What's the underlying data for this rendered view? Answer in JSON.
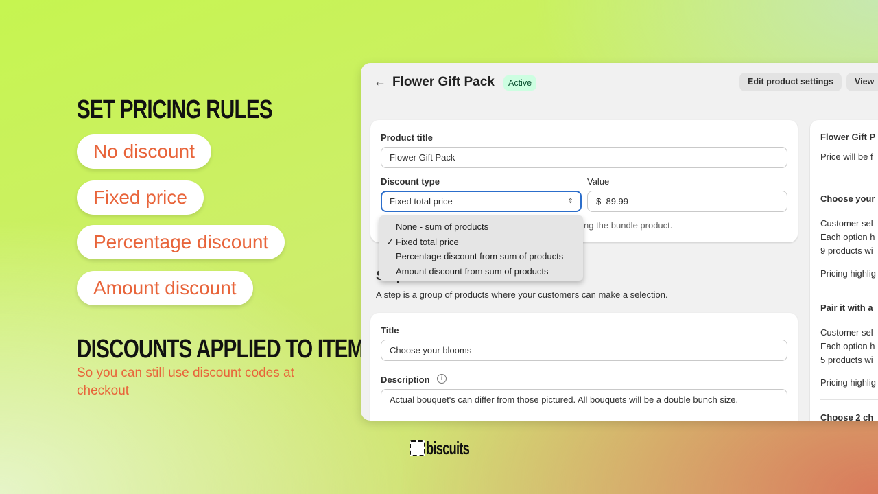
{
  "left": {
    "heading1": "SET PRICING RULES",
    "pills": [
      "No discount",
      "Fixed price",
      "Percentage discount",
      "Amount discount"
    ],
    "heading2": "DISCOUNTS APPLIED TO ITEMS",
    "subtitle": "So you can still use discount codes at checkout",
    "logo": "biscuits"
  },
  "header": {
    "title": "Flower Gift Pack",
    "status": "Active",
    "edit_button": "Edit product settings",
    "view_button": "View"
  },
  "product_card": {
    "title_label": "Product title",
    "title_value": "Flower Gift Pack",
    "discount_label": "Discount type",
    "discount_value": "Fixed total price",
    "value_label": "Value",
    "currency": "$",
    "value": "89.99",
    "helper_fragment": "ng the bundle product.",
    "options": [
      "None - sum of products",
      "Fixed total price",
      "Percentage discount from sum of products",
      "Amount discount from sum of products"
    ],
    "selected_index": 1
  },
  "steps": {
    "heading": "Steps",
    "description": "A step is a group of products where your customers can make a selection.",
    "title_label": "Title",
    "title_value": "Choose your blooms",
    "description_label": "Description",
    "description_value": "Actual bouquet's can differ from those pictured. All bouquets will be a double bunch size."
  },
  "summary": {
    "title": "Flower Gift P",
    "price_text": "Price will be f",
    "sections": [
      {
        "title": "Choose your",
        "lines": [
          "Customer sel",
          "Each option h",
          "9 products wi"
        ],
        "pricing": "Pricing highlig"
      },
      {
        "title": "Pair it with a",
        "lines": [
          "Customer sel",
          "Each option h",
          "5 products wi"
        ],
        "pricing": "Pricing highlig"
      }
    ],
    "last_title": "Choose 2 ch"
  },
  "colors": {
    "accent": "#e8643a",
    "focus": "#2c6ecb",
    "badge_bg": "#cdfee1"
  }
}
